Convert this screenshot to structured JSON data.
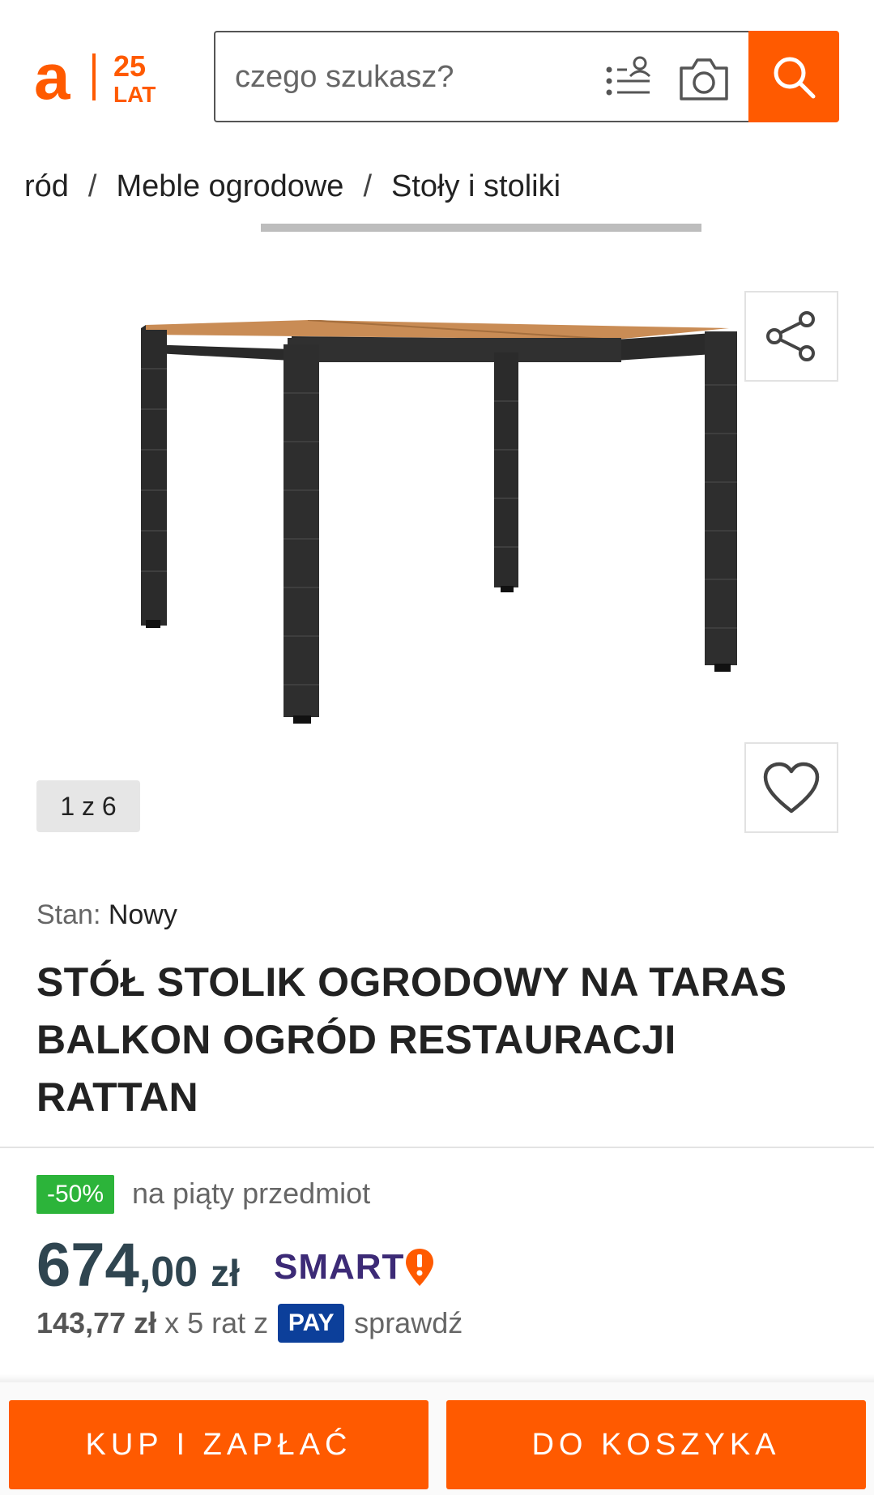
{
  "brand": {
    "logo_letter": "a",
    "anniversary_number": "25",
    "anniversary_label": "LAT",
    "accent_color": "#ff5a00"
  },
  "search": {
    "placeholder": "czego szukasz?",
    "icons": [
      "voice-search-icon",
      "camera-icon",
      "search-icon"
    ]
  },
  "breadcrumb": {
    "items": [
      "ród",
      "Meble ogrodowe",
      "Stoły i stoliki"
    ],
    "separator": "/"
  },
  "gallery": {
    "counter": "1 z 6",
    "current_image": 1,
    "total_images": 6
  },
  "product": {
    "condition_label": "Stan:",
    "condition_value": "Nowy",
    "title": "STÓŁ STOLIK OGRODOWY NA TARAS BALKON OGRÓD RESTAURACJI RATTAN"
  },
  "promo": {
    "badge": "-50%",
    "text": "na piąty przedmiot",
    "badge_color": "#2cb43a"
  },
  "price": {
    "main": "674",
    "decimal": ",00",
    "currency": "zł",
    "smart_label": "SMART",
    "color": "#2f4550"
  },
  "installments": {
    "amount": "143,77 zł",
    "text": "x 5 rat z",
    "pay_label": "PAY",
    "check_label": "sprawdź"
  },
  "actions": {
    "buy_label": "KUP I ZAPŁAĆ",
    "cart_label": "DO KOSZYKA"
  }
}
